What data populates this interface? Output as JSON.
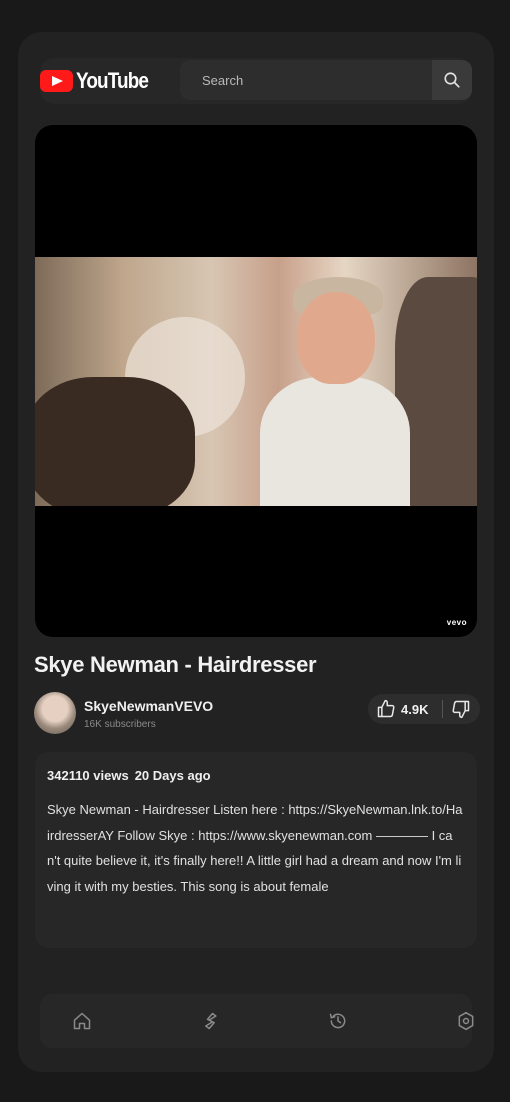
{
  "header": {
    "logo_text": "YouTube",
    "search_placeholder": "Search"
  },
  "video": {
    "watermark": "vevo",
    "title": "Skye Newman - Hairdresser"
  },
  "channel": {
    "name": "SkyeNewmanVEVO",
    "subscribers": "16K subscribers"
  },
  "actions": {
    "like_count": "4.9K"
  },
  "description": {
    "views": "342110 views",
    "posted": "20 Days ago",
    "text": "Skye Newman - Hairdresser Listen here : https://SkyeNewman.lnk.to/HairdresserAY Follow Skye : https://www.skyenewman.com ———— I can't quite believe it, it's finally here!! A little girl had a dream and now I'm living it with my besties. This song is about female"
  },
  "nav": {
    "items": [
      "home-icon",
      "shorts-icon",
      "history-icon",
      "settings-icon"
    ]
  },
  "colors": {
    "background": "#191919",
    "panel": "#222222",
    "card": "#272727",
    "brand_red": "#ff1a1a"
  }
}
